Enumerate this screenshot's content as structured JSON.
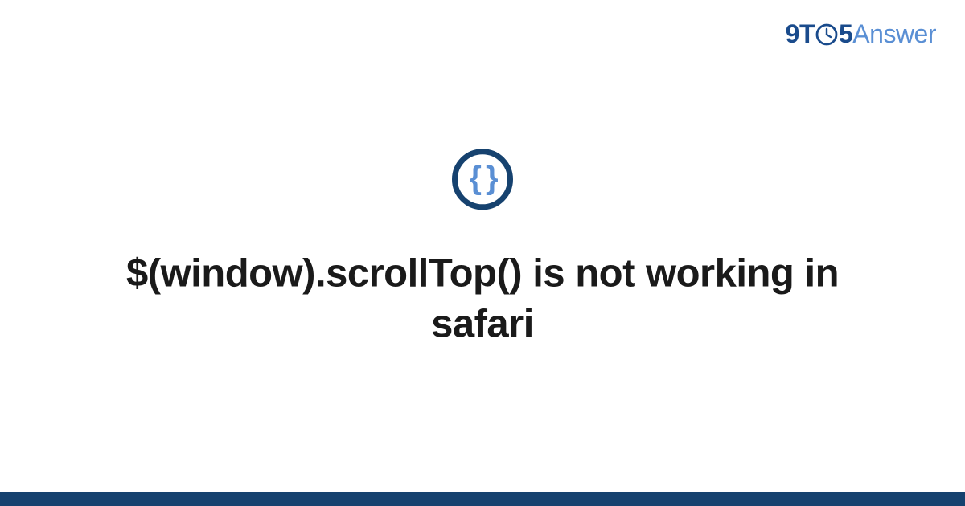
{
  "logo": {
    "part1": "9T",
    "part2": "5",
    "part3": "Answer"
  },
  "icon": {
    "braces": "{ }"
  },
  "title": "$(window).scrollTop() is not working in safari",
  "colors": {
    "darkBlue": "#16426f",
    "logoBlue": "#1a4b8c",
    "lightBlue": "#5a8fd4"
  }
}
